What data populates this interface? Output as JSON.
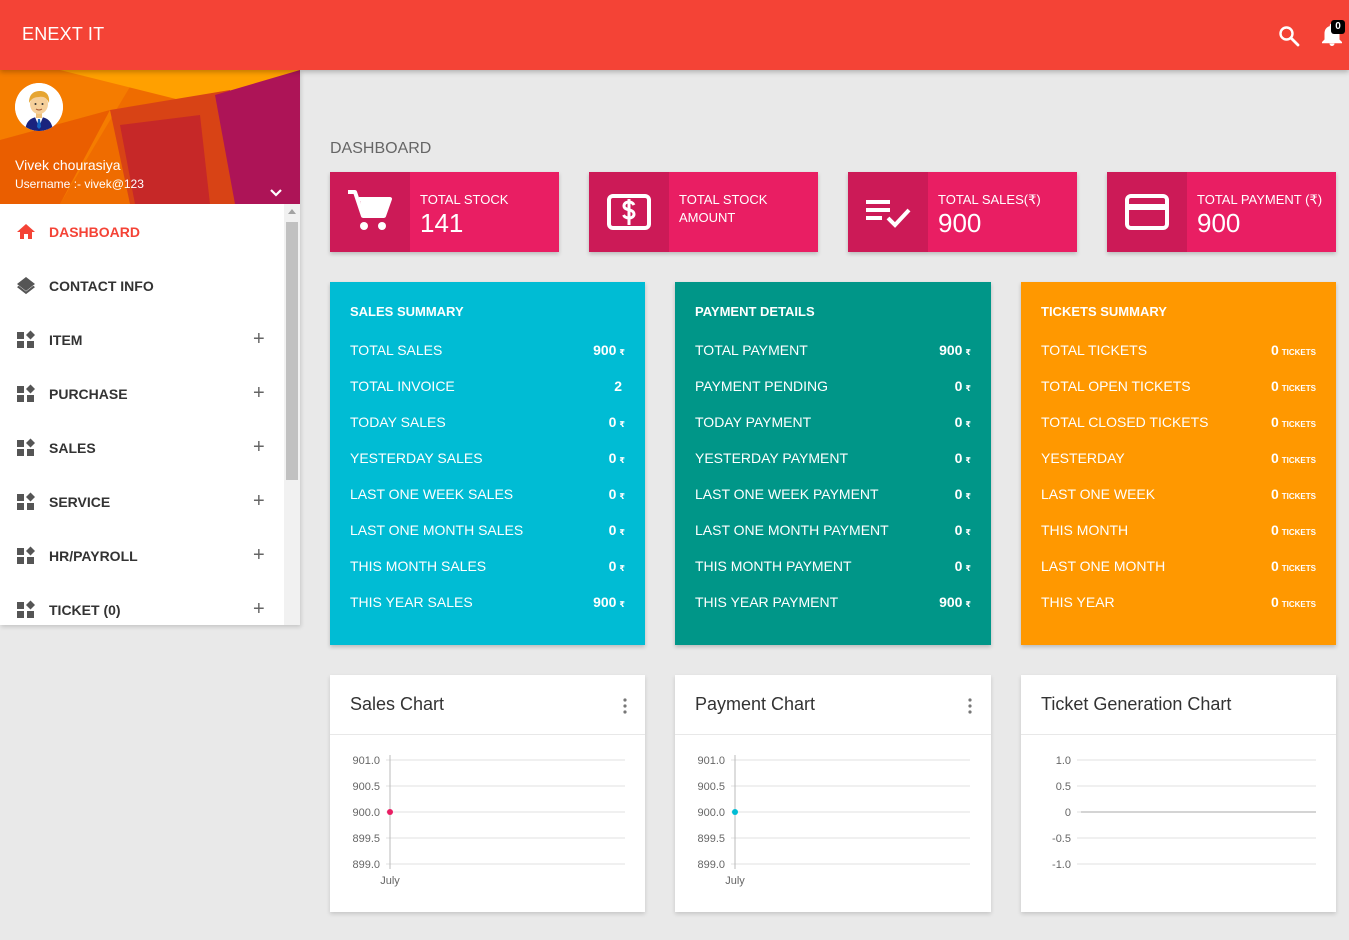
{
  "header": {
    "brand": "ENEXT IT",
    "notification_count": "0"
  },
  "colors": {
    "header": "#f44336",
    "pink": "#e91e63",
    "cyan": "#00bcd4",
    "teal": "#009688",
    "orange": "#ff9800"
  },
  "user": {
    "name": "Vivek chourasiya",
    "username": "Username :- vivek@123"
  },
  "sidebar": {
    "items": [
      {
        "label": "DASHBOARD",
        "icon": "home-icon",
        "active": true
      },
      {
        "label": "CONTACT INFO",
        "icon": "layers-icon"
      },
      {
        "label": "ITEM",
        "icon": "widgets-icon"
      },
      {
        "label": "PURCHASE",
        "icon": "widgets-icon"
      },
      {
        "label": "SALES",
        "icon": "widgets-icon"
      },
      {
        "label": "SERVICE",
        "icon": "widgets-icon"
      },
      {
        "label": "HR/PAYROLL",
        "icon": "widgets-icon"
      },
      {
        "label": "TICKET (0)",
        "icon": "widgets-icon"
      }
    ]
  },
  "page": {
    "title": "DASHBOARD"
  },
  "info_boxes": [
    {
      "label": "TOTAL STOCK",
      "value": "141",
      "icon": "cart-icon"
    },
    {
      "label": "TOTAL STOCK AMOUNT",
      "value": "",
      "icon": "money-icon"
    },
    {
      "label": "TOTAL SALES(₹)",
      "value": "900",
      "icon": "playlist-check-icon"
    },
    {
      "label": "TOTAL PAYMENT (₹)",
      "value": "900",
      "icon": "credit-card-icon"
    }
  ],
  "sales_summary": {
    "title": "SALES SUMMARY",
    "rows": [
      {
        "label": "TOTAL SALES",
        "value": "900",
        "unit": "₹"
      },
      {
        "label": "TOTAL INVOICE",
        "value": "2",
        "unit": ""
      },
      {
        "label": "TODAY SALES",
        "value": "0",
        "unit": "₹"
      },
      {
        "label": "YESTERDAY SALES",
        "value": "0",
        "unit": "₹"
      },
      {
        "label": "LAST ONE WEEK SALES",
        "value": "0",
        "unit": "₹"
      },
      {
        "label": "LAST ONE MONTH SALES",
        "value": "0",
        "unit": "₹"
      },
      {
        "label": "THIS MONTH SALES",
        "value": "0",
        "unit": "₹"
      },
      {
        "label": "THIS YEAR SALES",
        "value": "900",
        "unit": "₹"
      }
    ]
  },
  "payment_details": {
    "title": "PAYMENT DETAILS",
    "rows": [
      {
        "label": "TOTAL PAYMENT",
        "value": "900",
        "unit": "₹"
      },
      {
        "label": "PAYMENT PENDING",
        "value": "0",
        "unit": "₹"
      },
      {
        "label": "TODAY PAYMENT",
        "value": "0",
        "unit": "₹"
      },
      {
        "label": "YESTERDAY PAYMENT",
        "value": "0",
        "unit": "₹"
      },
      {
        "label": "LAST ONE WEEK PAYMENT",
        "value": "0",
        "unit": "₹"
      },
      {
        "label": "LAST ONE MONTH PAYMENT",
        "value": "0",
        "unit": "₹"
      },
      {
        "label": "THIS MONTH PAYMENT",
        "value": "0",
        "unit": "₹"
      },
      {
        "label": "THIS YEAR PAYMENT",
        "value": "900",
        "unit": "₹"
      }
    ]
  },
  "tickets_summary": {
    "title": "TICKETS SUMMARY",
    "rows": [
      {
        "label": "TOTAL TICKETS",
        "value": "0",
        "unit": "TICKETS"
      },
      {
        "label": "TOTAL OPEN TICKETS",
        "value": "0",
        "unit": "TICKETS"
      },
      {
        "label": "TOTAL CLOSED TICKETS",
        "value": "0",
        "unit": "TICKETS"
      },
      {
        "label": "YESTERDAY",
        "value": "0",
        "unit": "TICKETS"
      },
      {
        "label": "LAST ONE WEEK",
        "value": "0",
        "unit": "TICKETS"
      },
      {
        "label": "THIS MONTH",
        "value": "0",
        "unit": "TICKETS"
      },
      {
        "label": "LAST ONE MONTH",
        "value": "0",
        "unit": "TICKETS"
      },
      {
        "label": "THIS YEAR",
        "value": "0",
        "unit": "TICKETS"
      }
    ]
  },
  "chart_data": [
    {
      "type": "line",
      "title": "Sales Chart",
      "categories": [
        "July"
      ],
      "series": [
        {
          "values": [
            900
          ],
          "color": "#e91e63"
        }
      ],
      "yticks": [
        "901.0",
        "900.5",
        "900.0",
        "899.5",
        "899.0"
      ],
      "ylim": [
        899,
        901
      ],
      "grid": true
    },
    {
      "type": "line",
      "title": "Payment Chart",
      "categories": [
        "July"
      ],
      "series": [
        {
          "values": [
            900
          ],
          "color": "#00bcd4"
        }
      ],
      "yticks": [
        "901.0",
        "900.5",
        "900.0",
        "899.5",
        "899.0"
      ],
      "ylim": [
        899,
        901
      ],
      "grid": true
    },
    {
      "type": "line",
      "title": "Ticket Generation Chart",
      "categories": [],
      "series": [],
      "yticks": [
        "1.0",
        "0.5",
        "0",
        "-0.5",
        "-1.0"
      ],
      "ylim": [
        -1,
        1
      ],
      "grid": true
    }
  ]
}
